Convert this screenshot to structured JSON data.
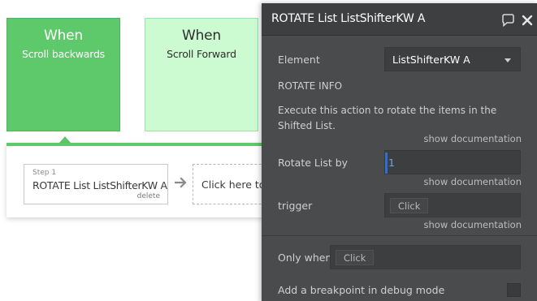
{
  "events": {
    "backward": {
      "when": "When",
      "name": "Scroll backwards",
      "color": "#5ec96b"
    },
    "forward": {
      "when": "When",
      "name": "Scroll Forward",
      "color": "#ccfbd2"
    }
  },
  "workflow": {
    "step": {
      "number": "Step 1",
      "title": "ROTATE List ListShifterKW A",
      "delete": "delete"
    },
    "add_step": "Click here to a"
  },
  "panel": {
    "title": "ROTATE List ListShifterKW A",
    "element_label": "Element",
    "element_value": "ListShifterKW A",
    "section_title": "ROTATE INFO",
    "description": "Execute this action to rotate the items in the Shifted List.",
    "show_documentation": "show documentation",
    "rotate_label": "Rotate List by",
    "rotate_value": "1",
    "trigger_label": "trigger",
    "trigger_chip": "Click",
    "only_when_label": "Only when",
    "only_when_chip": "Click",
    "breakpoint_label": "Add a breakpoint in debug mode",
    "breakpoint_checked": false
  },
  "icons": {
    "comment": "comment-icon",
    "close": "close-icon",
    "arrow": "arrow-right-icon",
    "dropdown": "chevron-down-icon"
  },
  "colors": {
    "event_green": "#5ec96b",
    "event_light_green": "#ccfbd2",
    "panel_bg": "#4a4b4d",
    "input_bg": "#3d3e40",
    "accent_blue": "#2f6fd0"
  }
}
